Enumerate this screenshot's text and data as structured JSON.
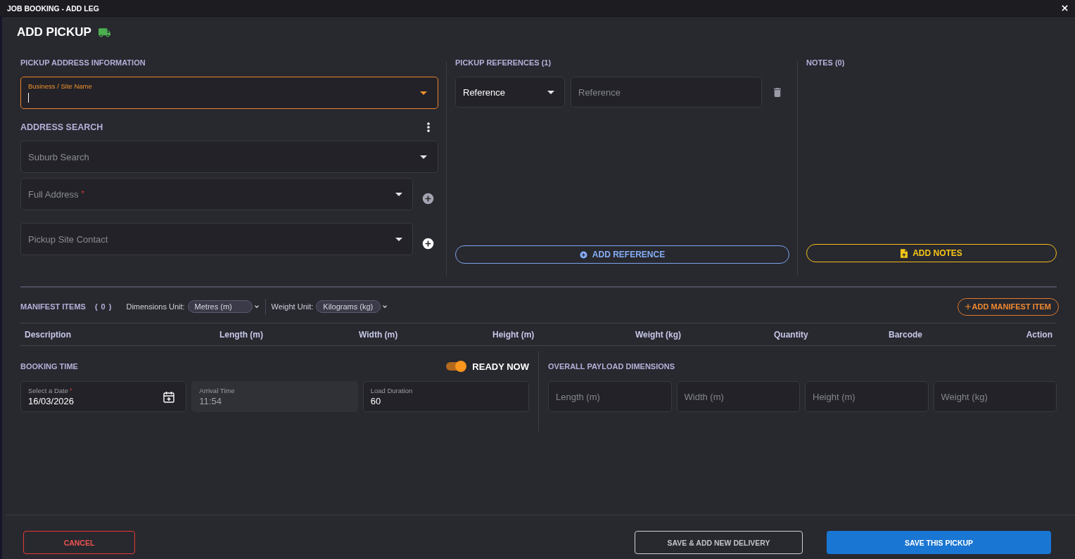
{
  "window": {
    "title": "JOB BOOKING - ADD LEG"
  },
  "header": {
    "title": "ADD PICKUP"
  },
  "address_info": {
    "title": "PICKUP ADDRESS INFORMATION",
    "business_field": {
      "label": "Business / Site Name",
      "focused": true
    }
  },
  "address_search": {
    "title": "ADDRESS SEARCH",
    "fields": [
      {
        "label": "Suburb Search"
      },
      {
        "label": "Full Address",
        "required_mark": "*",
        "add_button": {
          "disabled": true
        }
      },
      {
        "label": "Pickup Site Contact",
        "add_button": {
          "disabled": false
        }
      }
    ]
  },
  "references": {
    "title": "PICKUP REFERENCES (1)",
    "rows": [
      {
        "type": "Reference",
        "placeholder": "Reference"
      }
    ],
    "add_button": "ADD REFERENCE"
  },
  "notes": {
    "title": "NOTES (0)",
    "add_button": "ADD NOTES"
  },
  "manifest": {
    "title": "MANIFEST ITEMS",
    "count": "( 0 )",
    "units": [
      {
        "label": "Dimensions Unit:",
        "value": "Metres (m)"
      },
      {
        "label": "Weight Unit:",
        "value": "Kilograms (kg)"
      }
    ],
    "add_button": "ADD MANIFEST ITEM",
    "columns": [
      "Description",
      "Length (m)",
      "Width (m)",
      "Height (m)",
      "Weight (kg)",
      "Quantity",
      "Barcode",
      "Action"
    ]
  },
  "booking": {
    "title": "BOOKING TIME",
    "ready_now": {
      "label": "READY NOW",
      "on": true
    },
    "fields": [
      {
        "kind": "date",
        "label": "Select a Date",
        "required_mark": "*",
        "value": "16/03/2026",
        "disabled": false
      },
      {
        "kind": "time",
        "label": "Arrival Time",
        "value": "11:54",
        "disabled": true
      },
      {
        "kind": "duration",
        "label": "Load Duration",
        "value": "60",
        "disabled": false
      }
    ]
  },
  "payload": {
    "title": "OVERALL PAYLOAD DIMENSIONS",
    "fields": [
      {
        "placeholder": "Length (m)"
      },
      {
        "placeholder": "Width (m)"
      },
      {
        "placeholder": "Height (m)"
      },
      {
        "placeholder": "Weight (kg)"
      }
    ]
  },
  "footer": {
    "buttons": [
      {
        "label": "CANCEL",
        "kind": "cancel"
      },
      {
        "label": "SAVE & ADD NEW DELIVERY",
        "kind": "secondary"
      },
      {
        "label": "SAVE THIS PICKUP",
        "kind": "primary"
      }
    ]
  }
}
